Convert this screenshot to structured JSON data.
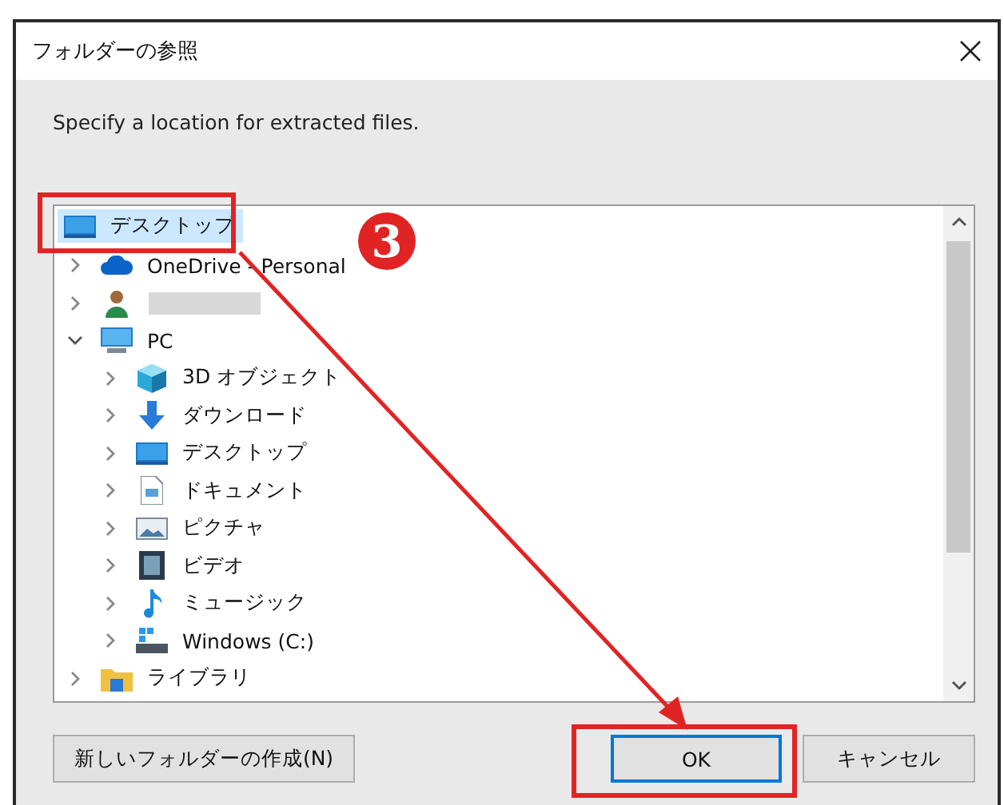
{
  "window": {
    "title": "フォルダーの参照"
  },
  "message": "Specify a location for extracted files.",
  "tree": {
    "root": {
      "label": "デスクトップ",
      "kind": "desktop",
      "selected": true
    },
    "items": [
      {
        "label": "OneDrive - Personal",
        "kind": "cloud",
        "expanded": false,
        "selected": false
      },
      {
        "kind": "user",
        "redacted": true,
        "expanded": false,
        "selected": false
      },
      {
        "label": "PC",
        "kind": "pc",
        "expanded": true,
        "selected": false,
        "children": [
          {
            "label": "3D オブジェクト",
            "kind": "cube",
            "expanded": false,
            "selected": false
          },
          {
            "label": "ダウンロード",
            "kind": "download",
            "expanded": false,
            "selected": false
          },
          {
            "label": "デスクトップ",
            "kind": "desktop",
            "expanded": false,
            "selected": false
          },
          {
            "label": "ドキュメント",
            "kind": "document",
            "expanded": false,
            "selected": false
          },
          {
            "label": "ピクチャ",
            "kind": "picture",
            "expanded": false,
            "selected": false
          },
          {
            "label": "ビデオ",
            "kind": "video",
            "expanded": false,
            "selected": false
          },
          {
            "label": "ミュージック",
            "kind": "music",
            "expanded": false,
            "selected": false
          },
          {
            "label": "Windows (C:)",
            "kind": "drive",
            "expanded": false,
            "selected": false
          }
        ]
      },
      {
        "label": "ライブラリ",
        "kind": "library",
        "expanded": false,
        "selected": false
      }
    ]
  },
  "buttons": [
    {
      "label": "新しいフォルダーの作成(N)",
      "kind": "secondary"
    },
    {
      "label": "OK",
      "kind": "default"
    },
    {
      "label": "キャンセル",
      "kind": "secondary"
    }
  ],
  "annotation": {
    "badge": "3"
  }
}
